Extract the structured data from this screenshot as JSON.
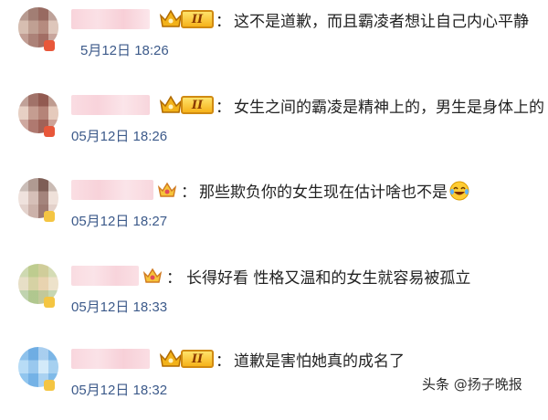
{
  "comments": [
    {
      "colon": "：",
      "text": "这不是道歉，而且霸凌者想让自己内心平静",
      "time": "5月12日 18:26",
      "level": "II",
      "crown": "crown-icon"
    },
    {
      "colon": "：",
      "text": "女生之间的霸凌是精神上的，男生是身体上的",
      "time": "05月12日 18:26",
      "level": "II",
      "crown": "crown-icon"
    },
    {
      "colon": "：",
      "text": "那些欺负你的女生现在估计啥也不是",
      "time": "05月12日 18:27",
      "emoji": "laughing-crying-emoji",
      "crown": "small-crown-icon"
    },
    {
      "colon": "：",
      "text": "长得好看 性格又温和的女生就容易被孤立",
      "time": "05月12日 18:33",
      "crown": "small-crown-icon"
    },
    {
      "colon": "：",
      "text": "道歉是害怕她真的成名了",
      "time": "05月12日 18:32",
      "level": "II",
      "crown": "crown-icon"
    }
  ],
  "watermark": {
    "source": "头条",
    "handle": "@扬子晚报"
  },
  "colors": {
    "time": "#3c5a8a",
    "crown": "#f2b21a",
    "level_border": "#d08a12"
  }
}
